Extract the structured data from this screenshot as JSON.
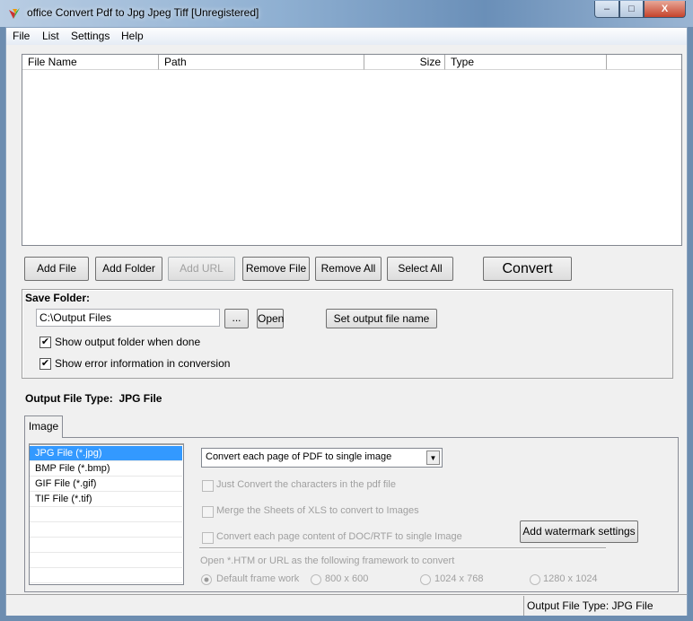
{
  "window": {
    "title": "office Convert Pdf to Jpg Jpeg Tiff [Unregistered]",
    "minimize": "–",
    "maximize": "□",
    "close": "X"
  },
  "menu": [
    "File",
    "List",
    "Settings",
    "Help"
  ],
  "file_list": {
    "columns": [
      "File Name",
      "Path",
      "Size",
      "Type"
    ],
    "rows": []
  },
  "buttons": {
    "add_file": "Add File",
    "add_folder": "Add Folder",
    "add_url": "Add URL",
    "remove_file": "Remove File",
    "remove_all": "Remove All",
    "select_all": "Select All",
    "convert": "Convert"
  },
  "save_folder": {
    "label": "Save Folder:",
    "path": "C:\\Output Files",
    "browse": "...",
    "open": "Open",
    "set_name": "Set output file name",
    "show_folder": {
      "label": "Show output folder when done",
      "checked": true
    },
    "show_error": {
      "label": "Show error information in conversion",
      "checked": true
    }
  },
  "output_type": {
    "label": "Output File Type:",
    "value": "JPG File"
  },
  "tabs": [
    "Image"
  ],
  "formats": [
    {
      "label": "JPG File  (*.jpg)",
      "selected": true
    },
    {
      "label": "BMP File  (*.bmp)"
    },
    {
      "label": "GIF File  (*.gif)"
    },
    {
      "label": "TIF File  (*.tif)"
    }
  ],
  "mode_select": "Convert each page of PDF to single image",
  "options": [
    "Just Convert the characters in the pdf file",
    "Merge the Sheets of XLS to convert to Images",
    "Convert each page content of DOC/RTF to single Image"
  ],
  "watermark_button": "Add watermark settings",
  "framework": {
    "label": "Open *.HTM or URL as the following framework to convert",
    "options": [
      {
        "label": "Default frame work",
        "checked": true
      },
      {
        "label": "800 x 600"
      },
      {
        "label": "1024 x 768"
      },
      {
        "label": "1280 x 1024"
      }
    ]
  },
  "status": "Output File Type:  JPG File",
  "colors": {
    "selection": "#3399ff",
    "client": "#f0f0f0"
  }
}
